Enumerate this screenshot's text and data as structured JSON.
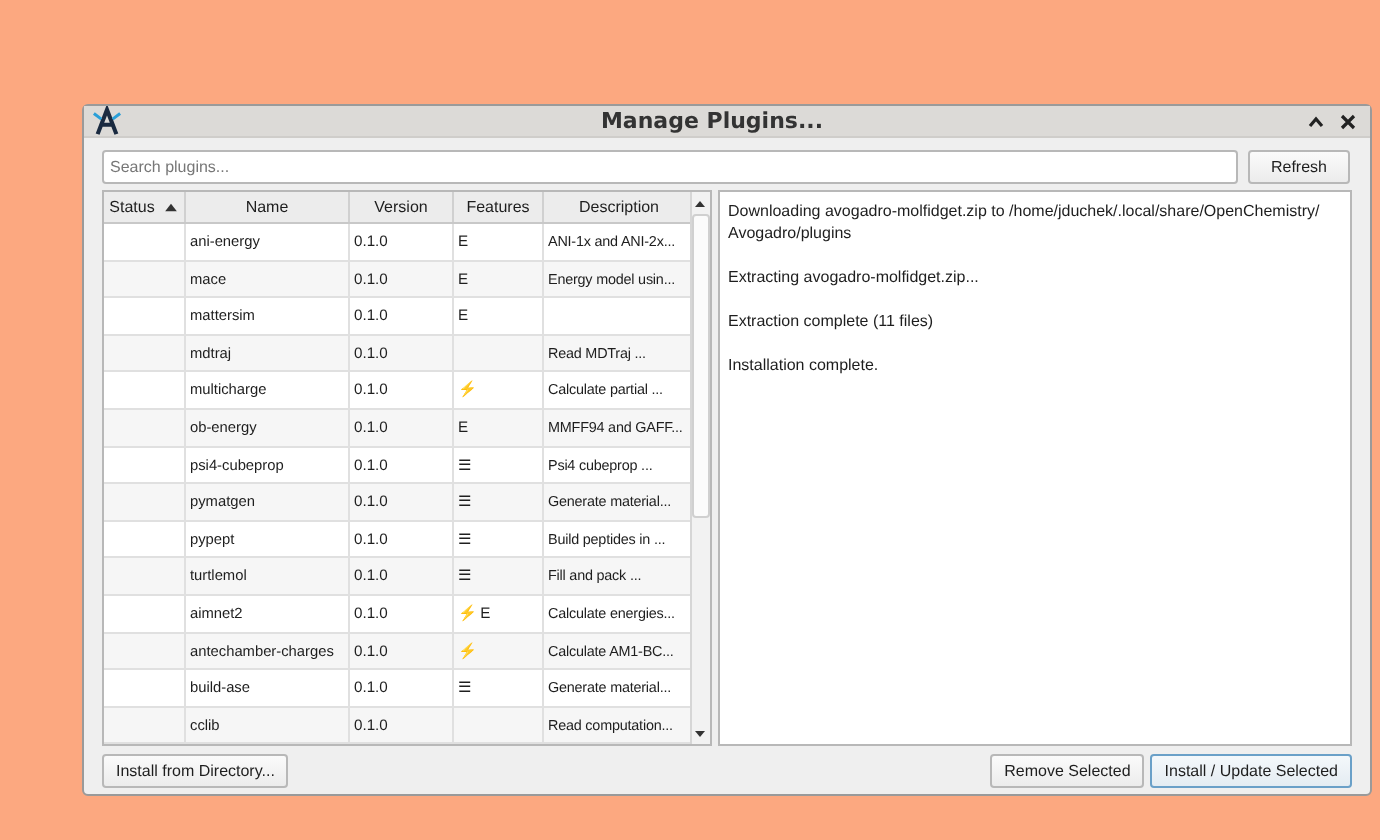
{
  "window": {
    "title": "Manage Plugins..."
  },
  "search": {
    "placeholder": "Search plugins..."
  },
  "refresh_button": "Refresh",
  "table": {
    "columns": [
      {
        "label": "Status",
        "sorted": true
      },
      {
        "label": "Name",
        "sorted": false
      },
      {
        "label": "Version",
        "sorted": false
      },
      {
        "label": "Features",
        "sorted": false
      },
      {
        "label": "Description",
        "sorted": false
      }
    ],
    "rows": [
      {
        "status": "",
        "name": "ani-energy",
        "version": "0.1.0",
        "features": "E",
        "description": "ANI-1x and ANI-2x..."
      },
      {
        "status": "",
        "name": "mace",
        "version": "0.1.0",
        "features": "E",
        "description": "Energy model usin..."
      },
      {
        "status": "",
        "name": "mattersim",
        "version": "0.1.0",
        "features": "E",
        "description": ""
      },
      {
        "status": "",
        "name": "mdtraj",
        "version": "0.1.0",
        "features": "",
        "description": "Read MDTraj ..."
      },
      {
        "status": "",
        "name": "multicharge",
        "version": "0.1.0",
        "features": "⚡",
        "description": "Calculate partial ..."
      },
      {
        "status": "",
        "name": "ob-energy",
        "version": "0.1.0",
        "features": "E",
        "description": "MMFF94 and GAFF..."
      },
      {
        "status": "",
        "name": "psi4-cubeprop",
        "version": "0.1.0",
        "features": "☰",
        "description": "Psi4 cubeprop ..."
      },
      {
        "status": "",
        "name": "pymatgen",
        "version": "0.1.0",
        "features": "☰",
        "description": "Generate material..."
      },
      {
        "status": "",
        "name": "pypept",
        "version": "0.1.0",
        "features": "☰",
        "description": "Build peptides in ..."
      },
      {
        "status": "",
        "name": "turtlemol",
        "version": "0.1.0",
        "features": "☰",
        "description": "Fill and pack ..."
      },
      {
        "status": "",
        "name": "aimnet2",
        "version": "0.1.0",
        "features": "⚡ E",
        "description": "Calculate energies..."
      },
      {
        "status": "",
        "name": "antechamber-charges",
        "version": "0.1.0",
        "features": "⚡",
        "description": "Calculate AM1-BC..."
      },
      {
        "status": "",
        "name": "build-ase",
        "version": "0.1.0",
        "features": "☰",
        "description": "Generate material..."
      },
      {
        "status": "",
        "name": "cclib",
        "version": "0.1.0",
        "features": "",
        "description": "Read computation..."
      }
    ]
  },
  "log": [
    "Downloading avogadro-molfidget.zip to /home/jduchek/.local/share/OpenChemistry/ Avogadro/plugins",
    "Extracting avogadro-molfidget.zip...",
    "Extraction complete (11 files)",
    "Installation complete."
  ],
  "buttons": {
    "left": [
      "Install from Directory..."
    ],
    "right": [
      {
        "label": "Remove Selected",
        "default": false
      },
      {
        "label": "Install / Update Selected",
        "default": true
      }
    ]
  }
}
